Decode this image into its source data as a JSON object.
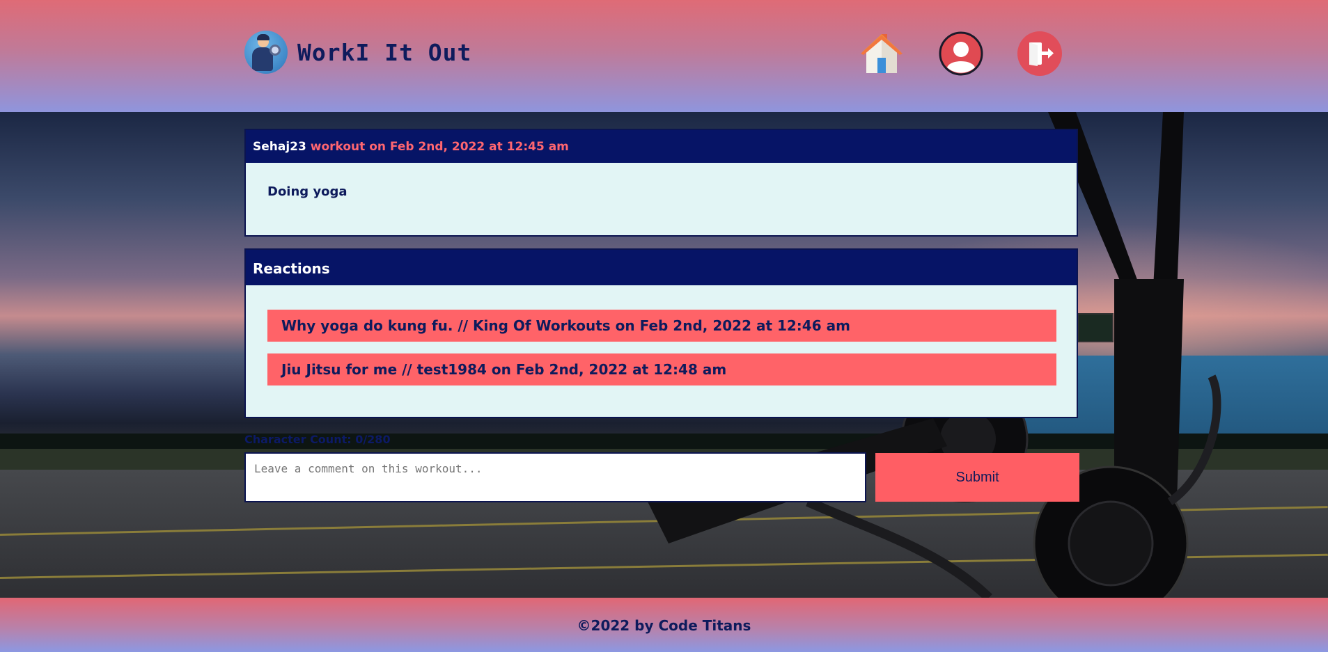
{
  "header": {
    "brand_name": "WorkI It Out",
    "nav": {
      "home_icon": "home-icon",
      "profile_icon": "profile-icon",
      "logout_icon": "logout-icon"
    }
  },
  "post": {
    "username": "Sehaj23",
    "meta": "workout on Feb 2nd, 2022 at 12:45 am",
    "body": "Doing yoga"
  },
  "reactions": {
    "title": "Reactions",
    "items": [
      {
        "text": "Why yoga do kung fu. // King Of Workouts on Feb 2nd, 2022 at 12:46 am"
      },
      {
        "text": "Jiu Jitsu for me // test1984 on Feb 2nd, 2022 at 12:48 am"
      }
    ]
  },
  "comment_form": {
    "char_count": "Character Count: 0/280",
    "placeholder": "Leave a comment on this workout...",
    "value": "",
    "submit_label": "Submit"
  },
  "footer": {
    "text": "©2022 by Code Titans"
  },
  "colors": {
    "header_top": "#df6b76",
    "header_bottom": "#8f95dd",
    "card_header": "#061466",
    "accent": "#ff6368",
    "card_body": "#e2f5f5",
    "text_dark": "#0e1b5c"
  }
}
